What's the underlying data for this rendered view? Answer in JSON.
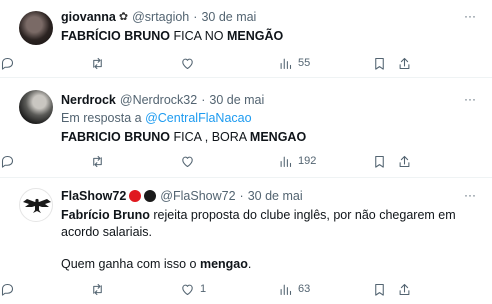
{
  "tweets": [
    {
      "name": "giovanna",
      "verified_icon": "✿",
      "handle": "@srtagioh",
      "sep": "·",
      "date": "30 de mai",
      "text_parts": [
        "FABRÍCIO BRUNO",
        " FICA NO ",
        "MENGÃO"
      ],
      "replies": "",
      "retweets": "",
      "likes": "",
      "views": "55"
    },
    {
      "name": "Nerdrock",
      "handle": "@Nerdrock32",
      "sep": "·",
      "date": "30 de mai",
      "reply_prefix": "Em resposta a ",
      "reply_to": "@CentralFlaNacao",
      "text_parts": [
        "FABRICIO BRUNO",
        " FICA , BORA ",
        "MENGAO"
      ],
      "replies": "",
      "retweets": "",
      "likes": "",
      "views": "192"
    },
    {
      "name": "FlaShow72",
      "handle": "@FlaShow72",
      "sep": "·",
      "date": "30 de mai",
      "text_parts": [
        "Fabrício Bruno",
        " rejeita proposta do clube inglês, por não chegarem em acordo salariais."
      ],
      "text2_parts": [
        "Quem ganha com isso o ",
        "mengao",
        "."
      ],
      "replies": "",
      "retweets": "",
      "likes": "1",
      "views": "63"
    }
  ],
  "more_icon": "···",
  "colors": {
    "link": "#1d9bf0",
    "muted": "#536471",
    "text": "#0f1419",
    "flag_red": "#e0191f",
    "flag_black": "#1a1a1a"
  }
}
